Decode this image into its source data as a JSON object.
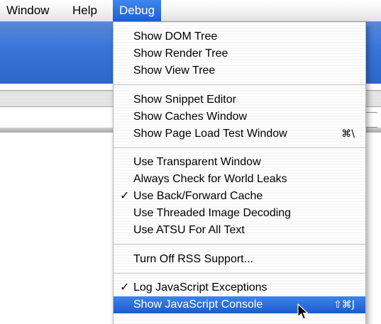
{
  "menubar": {
    "window_label": "Window",
    "help_label": "Help",
    "debug_label": "Debug"
  },
  "debug_menu": {
    "group1": [
      "Show DOM Tree",
      "Show Render Tree",
      "Show View Tree"
    ],
    "group2": {
      "snippet": "Show Snippet Editor",
      "caches": "Show Caches Window",
      "pageload": "Show Page Load Test Window",
      "pageload_shortcut": "⌘\\"
    },
    "group3": {
      "transparent": "Use Transparent Window",
      "leaks": "Always Check for World Leaks",
      "backforward": "Use Back/Forward Cache",
      "backforward_check": "✓",
      "threaded": "Use Threaded Image Decoding",
      "atsu": "Use ATSU For All Text"
    },
    "group4": {
      "rss": "Turn Off RSS Support..."
    },
    "group5": {
      "log_js": "Log JavaScript Exceptions",
      "log_js_check": "✓",
      "js_console": "Show JavaScript Console",
      "js_console_shortcut": "⇧⌘J"
    }
  },
  "colors": {
    "menu_highlight": "#2a6fe0",
    "toolbar_blue": "#3370d4"
  },
  "icons": [
    "checkmark-icon",
    "mouse-pointer-icon"
  ]
}
